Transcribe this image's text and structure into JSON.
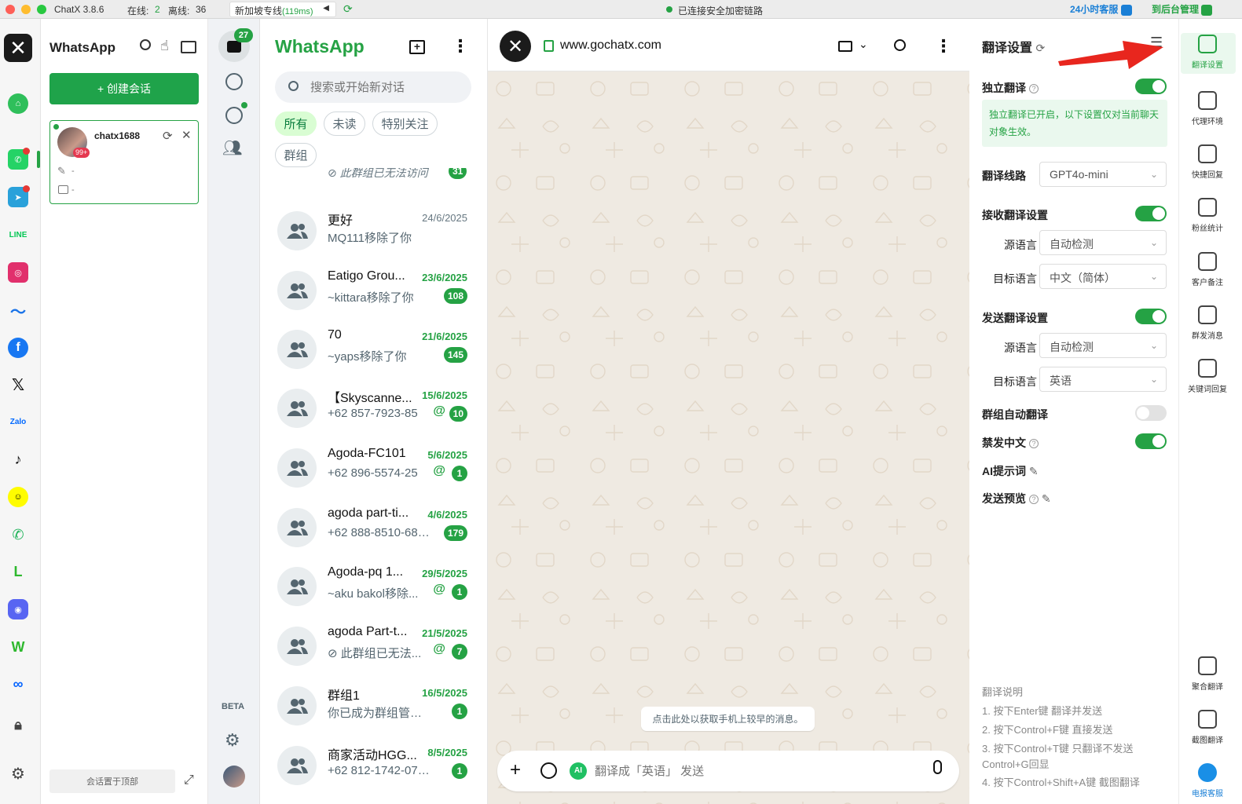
{
  "titlebar": {
    "app_version": "ChatX 3.8.6",
    "online_label": "在线:",
    "online_count": "2",
    "offline_label": "离线:",
    "offline_count": "36",
    "route_label": "新加坡专线",
    "route_latency": "(119ms)",
    "secure_status": "已连接安全加密链路",
    "support_button": "24小时客服",
    "admin_button": "到后台管理"
  },
  "sessions": {
    "title": "WhatsApp",
    "create_button": "+ 创建会话",
    "card": {
      "name": "chatx1688",
      "badge": "99+",
      "line1": "-",
      "line2": "-"
    },
    "pin_to_top": "会话置于顶部"
  },
  "wanav": {
    "unread_count": "27",
    "beta_label": "BETA"
  },
  "chatlist": {
    "title": "WhatsApp",
    "search_placeholder": "搜索或开始新对话",
    "filters": [
      "所有",
      "未读",
      "特别关注",
      "群组"
    ],
    "partial_top_msg": "⊘ 此群组已无法访问",
    "partial_top_badge": "31",
    "items": [
      {
        "name": "更好",
        "date": "24/6/2025",
        "msg": "MQ111移除了你",
        "badge": "",
        "at": false,
        "date_gray": true
      },
      {
        "name": "Eatigo Grou...",
        "date": "23/6/2025",
        "msg": "~kittara移除了你",
        "badge": "108",
        "at": false,
        "date_gray": false
      },
      {
        "name": "70",
        "date": "21/6/2025",
        "msg": "~yaps移除了你",
        "badge": "145",
        "at": false,
        "date_gray": false
      },
      {
        "name": "【Skyscanne...",
        "date": "15/6/2025",
        "msg": "+62 857-7923-85",
        "badge": "10",
        "at": true,
        "date_gray": false
      },
      {
        "name": "Agoda-FC101",
        "date": "5/6/2025",
        "msg": "+62 896-5574-25",
        "badge": "1",
        "at": true,
        "date_gray": false
      },
      {
        "name": "agoda part-ti...",
        "date": "4/6/2025",
        "msg": "+62 888-8510-682...",
        "badge": "179",
        "at": false,
        "date_gray": false
      },
      {
        "name": "Agoda-pq 1...",
        "date": "29/5/2025",
        "msg": "~aku bakol移除...",
        "badge": "1",
        "at": true,
        "date_gray": false
      },
      {
        "name": "agoda Part-t...",
        "date": "21/5/2025",
        "msg": "⊘ 此群组已无法...",
        "badge": "7",
        "at": true,
        "date_gray": false
      },
      {
        "name": "群组1",
        "date": "16/5/2025",
        "msg": "你已成为群组管理员",
        "badge": "1",
        "at": false,
        "date_gray": false
      },
      {
        "name": "商家活动HGG...",
        "date": "8/5/2025",
        "msg": "+62 812-1742-0711...",
        "badge": "1",
        "at": false,
        "date_gray": false
      }
    ]
  },
  "conversation": {
    "url": "www.gochatx.com",
    "notice": "点击此处以获取手机上较早的消息。",
    "input_placeholder": "翻译成「英语」 发送"
  },
  "translation": {
    "title": "翻译设置",
    "independent_label": "独立翻译",
    "independent_note": "独立翻译已开启，以下设置仅对当前聊天对象生效。",
    "route_label": "翻译线路",
    "route_value": "GPT4o-mini",
    "receive_label": "接收翻译设置",
    "source_label": "源语言",
    "target_label": "目标语言",
    "receive_source": "自动检测",
    "receive_target": "中文（简体）",
    "send_label": "发送翻译设置",
    "send_source": "自动检测",
    "send_target": "英语",
    "group_auto_label": "群组自动翻译",
    "ban_chinese_label": "禁发中文",
    "ai_prompt_label": "AI提示词",
    "send_preview_label": "发送预览",
    "guide_title": "翻译说明",
    "guide": [
      "1. 按下Enter键 翻译并发送",
      "2. 按下Control+F键 直接发送",
      "3. 按下Control+T键 只翻译不发送",
      "Control+G回显",
      "4. 按下Control+Shift+A键 截图翻译"
    ],
    "toggles": {
      "independent": true,
      "receive": true,
      "send": true,
      "group_auto": false,
      "ban_chinese": true
    }
  },
  "tools": {
    "items": [
      "翻译设置",
      "代理环境",
      "快捷回复",
      "粉丝统计",
      "客户备注",
      "群发消息",
      "关键词回复"
    ],
    "bottom": [
      "聚合翻译",
      "截图翻译",
      "电报客服"
    ]
  },
  "colors": {
    "accent": "#25a244",
    "wa_green": "#00a884",
    "annotation_arrow": "#e8261e"
  }
}
